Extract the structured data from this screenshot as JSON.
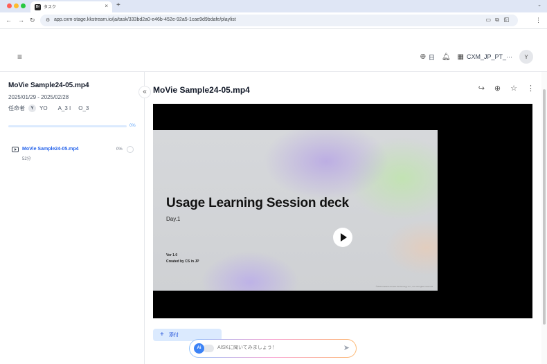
{
  "browser": {
    "tab_title": "タスク",
    "tab_favicon_text": "Dr",
    "url": "app.cxm-stage.kkstream.io/ja/task/333bd2a0-e46b-452e-92a5-1cae9d9bdafe/playlist"
  },
  "header": {
    "language_label": "日",
    "organization_label": "CXM_JP_PT_···",
    "user_initial": "Y"
  },
  "sidebar": {
    "title": "MoVie Sample24-05.mp4",
    "date_range": "2025/01/29 - 2025/02/28",
    "assignee_label": "任命者",
    "assignee_initial": "Y",
    "assignee_name": "YO",
    "assignee_extra1": "A_3 I",
    "assignee_extra2": "O_3",
    "progress_value": 0,
    "progress_label": "0%",
    "items": [
      {
        "name": "MoVie Sample24-05.mp4",
        "duration": "52分",
        "progress": "0%"
      }
    ]
  },
  "main": {
    "title": "MoVie Sample24-05.mp4",
    "slide": {
      "title": "Usage Learning Session deck",
      "subtitle": "Day.1",
      "version": "Ver 1.0",
      "credit": "Created by CS in JP",
      "footer": "©2024 Kaleido Kinetic Technology Co., Ltd. All rights reserved."
    },
    "attach_label": "添付",
    "ai": {
      "badge": "Ai",
      "placeholder": "AISKに聞いてみましょう！"
    }
  },
  "colors": {
    "accent": "#2563eb",
    "progress_track": "#dbeafe",
    "progress_fill": "#93c5fd"
  }
}
